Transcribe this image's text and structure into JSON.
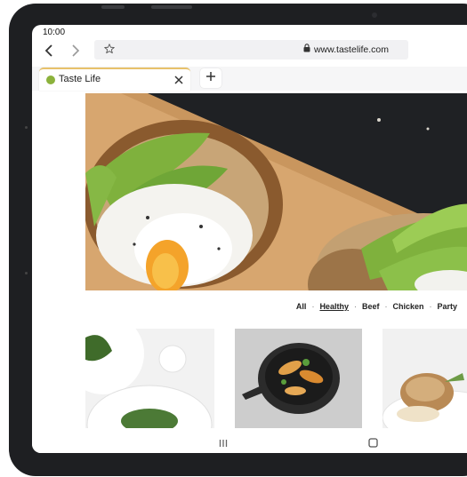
{
  "status": {
    "time": "10:00"
  },
  "browser": {
    "url": "www.tastelife.com",
    "tab": {
      "title": "Taste Life"
    }
  },
  "categories": [
    {
      "label": "All",
      "active": false
    },
    {
      "label": "Healthy",
      "active": true
    },
    {
      "label": "Beef",
      "active": false
    },
    {
      "label": "Chicken",
      "active": false
    },
    {
      "label": "Party",
      "active": false
    }
  ],
  "icons": [
    "back-icon",
    "forward-icon",
    "star-icon",
    "lock-icon",
    "close-icon",
    "plus-icon",
    "recents-icon",
    "home-icon"
  ],
  "colors": {
    "device": "#1e1f22",
    "tab_accent": "#e8c26a",
    "favicon": "#8cb23c",
    "avocado": "#6fa637"
  }
}
